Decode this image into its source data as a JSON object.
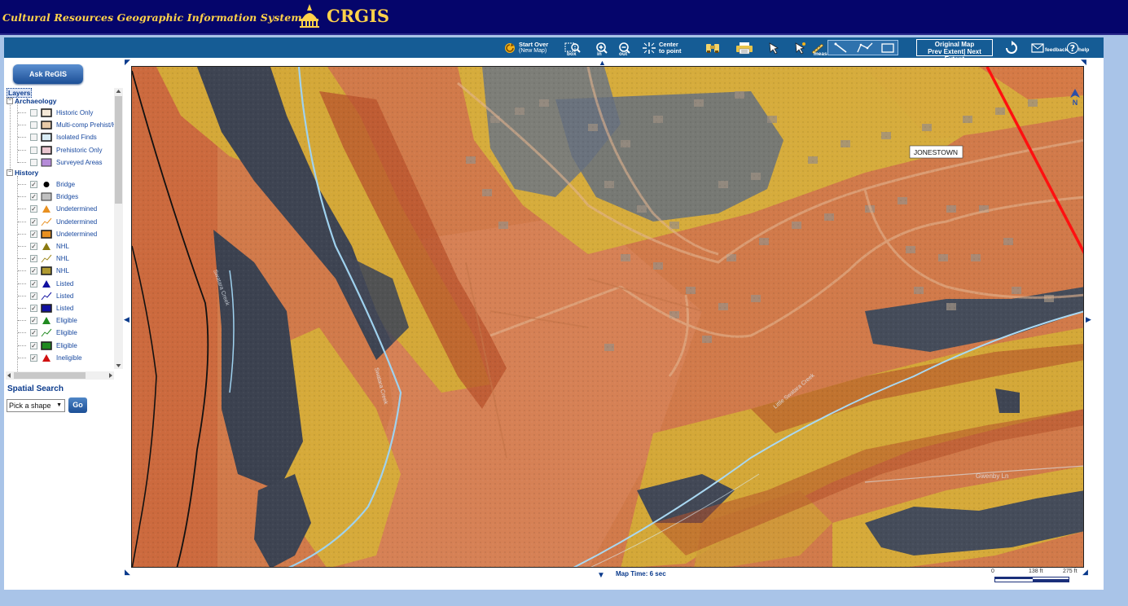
{
  "header": {
    "app_title": "Cultural Resources Geographic Information System",
    "logo_text": "CRGIS"
  },
  "toolbar": {
    "start_over": "Start Over",
    "start_over_sub": "(New Map)",
    "zoom_box": "box",
    "zoom_in": "in",
    "zoom_out": "out",
    "center": "Center",
    "center_sub": "to point",
    "measure": "measure",
    "extent_title": "Original Map",
    "extent_nav": "Prev Extent| Next Extent",
    "feedback": "feedback",
    "help": "help"
  },
  "left_panel": {
    "ask_button": "Ask ReGIS",
    "layers_header": "Layers",
    "groups": [
      {
        "name": "Archaeology",
        "items": [
          {
            "label": "Historic Only",
            "checked": false,
            "symbol": "box",
            "color": "#f5e9d8"
          },
          {
            "label": "Multi-comp Prehist/H",
            "checked": false,
            "symbol": "box",
            "color": "#e8c9a6"
          },
          {
            "label": "Isolated Finds",
            "checked": false,
            "symbol": "box",
            "color": "#d8ecf5"
          },
          {
            "label": "Prehistoric Only",
            "checked": false,
            "symbol": "box",
            "color": "#eac6cf"
          },
          {
            "label": "Surveyed Areas",
            "checked": false,
            "symbol": "box-fill",
            "color": "#b58bd8"
          }
        ]
      },
      {
        "name": "History",
        "items": [
          {
            "label": "Bridge",
            "checked": true,
            "symbol": "dot",
            "color": "#000000"
          },
          {
            "label": "Bridges",
            "checked": true,
            "symbol": "box-fill",
            "color": "#c0c0c0"
          },
          {
            "label": "Undetermined",
            "checked": true,
            "symbol": "triangle",
            "color": "#e89020"
          },
          {
            "label": "Undetermined",
            "checked": true,
            "symbol": "line",
            "color": "#e89020"
          },
          {
            "label": "Undetermined",
            "checked": true,
            "symbol": "box",
            "color": "#e89020"
          },
          {
            "label": "NHL",
            "checked": true,
            "symbol": "triangle",
            "color": "#8a7a10"
          },
          {
            "label": "NHL",
            "checked": true,
            "symbol": "line",
            "color": "#a08a20"
          },
          {
            "label": "NHL",
            "checked": true,
            "symbol": "box",
            "color": "#b09a30"
          },
          {
            "label": "Listed",
            "checked": true,
            "symbol": "triangle",
            "color": "#1010a0"
          },
          {
            "label": "Listed",
            "checked": true,
            "symbol": "line",
            "color": "#1010a0"
          },
          {
            "label": "Listed",
            "checked": true,
            "symbol": "box",
            "color": "#1010a0"
          },
          {
            "label": "Eligible",
            "checked": true,
            "symbol": "triangle",
            "color": "#208a20"
          },
          {
            "label": "Eligible",
            "checked": true,
            "symbol": "line",
            "color": "#208a20"
          },
          {
            "label": "Eligible",
            "checked": true,
            "symbol": "box",
            "color": "#208a20"
          },
          {
            "label": "Ineligible",
            "checked": true,
            "symbol": "triangle",
            "color": "#d01010"
          }
        ]
      }
    ],
    "spatial_search_title": "Spatial Search",
    "shape_select": "Pick a shape",
    "go_button": "Go"
  },
  "map": {
    "place_label": "JONESTOWN",
    "road_labels": [
      "Swatara Creek",
      "Little Swatara Creek",
      "Swatara Creek",
      "Gwenby Ln"
    ],
    "map_time": "Map Time: 6 sec",
    "scale_labels": [
      "0",
      "138 ft",
      "275 ft"
    ],
    "north_label": "N"
  },
  "colors": {
    "header_bg": "#05056b",
    "header_text": "#ffd24a",
    "toolbar_bg": "#155c95",
    "page_bg": "#a9c4e8",
    "map_orange": "#d47a4a",
    "map_yellow": "#d6ac3c",
    "map_dark": "#3f4552",
    "boundary_red": "#ff1010"
  }
}
